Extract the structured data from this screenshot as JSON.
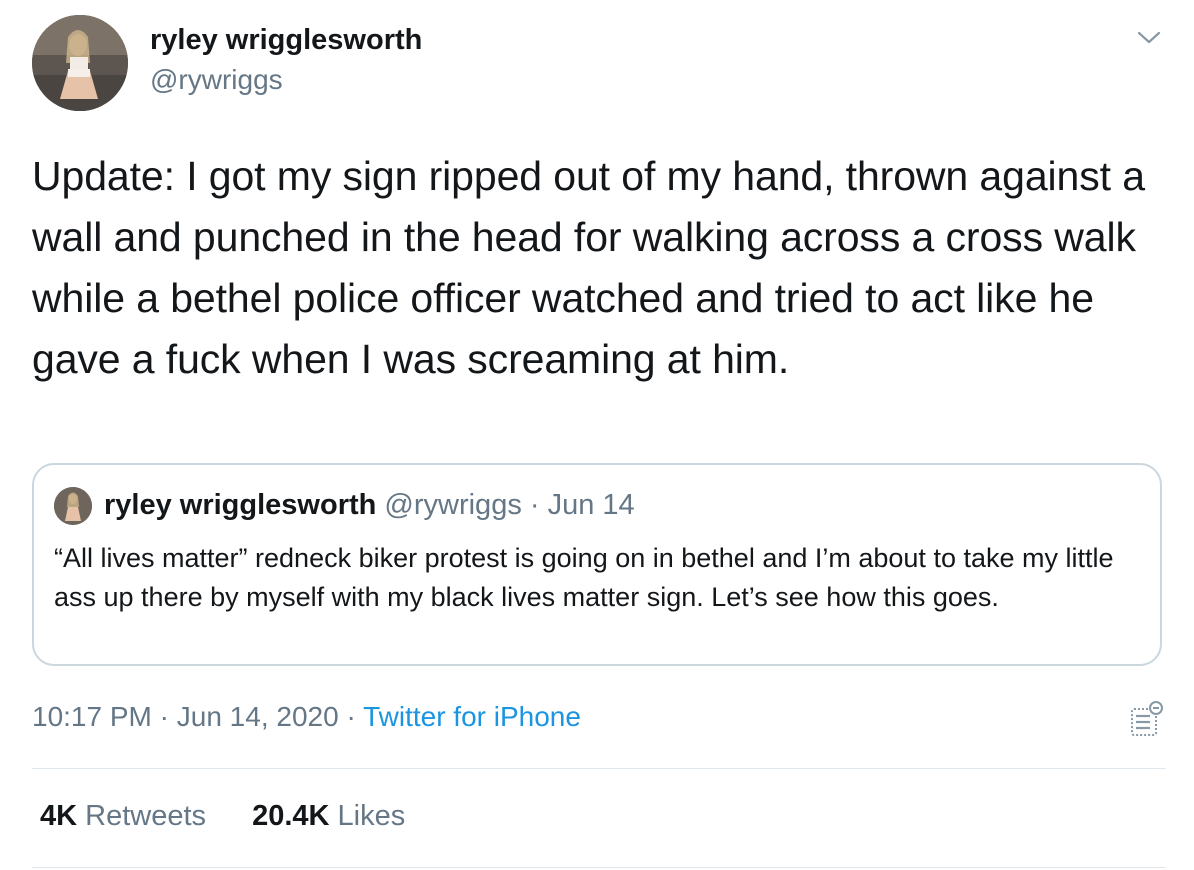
{
  "author": {
    "name": "ryley wrigglesworth",
    "handle": "@rywriggs"
  },
  "tweet": {
    "text": "Update: I got my sign ripped out of my hand, thrown against a wall and punched in the head for walking across a cross walk while a bethel police officer watched and tried to act like he gave a fuck when I was screaming at him."
  },
  "quoted": {
    "name": "ryley wrigglesworth",
    "handle": "@rywriggs",
    "separator": " · ",
    "date": "Jun 14",
    "text": "“All lives matter” redneck biker protest is going on in bethel and I’m about to take my little ass up there by myself with my black lives matter sign. Let’s see how this goes."
  },
  "meta": {
    "time": "10:17 PM",
    "separator": " · ",
    "date": "Jun 14, 2020",
    "source": "Twitter for iPhone"
  },
  "stats": {
    "retweets_count": "4K",
    "retweets_label": "Retweets",
    "likes_count": "20.4K",
    "likes_label": "Likes"
  },
  "icons": {
    "menu": "chevron-down-icon",
    "analytics": "analytics-icon"
  },
  "colors": {
    "text": "#14171a",
    "secondary": "#657786",
    "link": "#1b95e0",
    "border": "#ccd6dd"
  }
}
